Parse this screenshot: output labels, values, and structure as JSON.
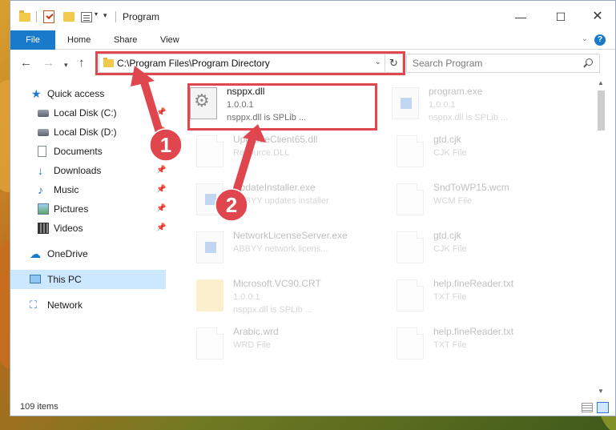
{
  "window": {
    "title": "Program",
    "min_glyph": "—",
    "max_glyph": "☐",
    "close_glyph": "✕"
  },
  "quick_access": {
    "arrow_glyph": "▾",
    "dropdown_glyph": "▾"
  },
  "ribbon": {
    "tabs": [
      "File",
      "Home",
      "Share",
      "View"
    ],
    "collapse_glyph": "⌄",
    "help_glyph": "?"
  },
  "address": {
    "path": "C:\\Program Files\\Program Directory",
    "dropdown_glyph": "⌄",
    "refresh_glyph": "↻",
    "back_glyph": "←",
    "forward_glyph": "→",
    "recent_glyph": "▾",
    "up_glyph": "↑"
  },
  "search": {
    "placeholder": "Search Program"
  },
  "nav": {
    "items": [
      {
        "label": "Quick access",
        "icon": "star-icon",
        "glyph": "★"
      },
      {
        "label": "Local Disk (C:)",
        "icon": "drive-icon",
        "pin": "📌"
      },
      {
        "label": "Local Disk (D:)",
        "icon": "drive-icon",
        "pin": "📌"
      },
      {
        "label": "Documents",
        "icon": "document-icon",
        "pin": "📌"
      },
      {
        "label": "Downloads",
        "icon": "download-icon",
        "glyph": "↓",
        "pin": "📌"
      },
      {
        "label": "Music",
        "icon": "music-icon",
        "glyph": "♪",
        "pin": "📌"
      },
      {
        "label": "Pictures",
        "icon": "pictures-icon",
        "pin": "📌"
      },
      {
        "label": "Videos",
        "icon": "video-icon",
        "pin": "📌"
      },
      {
        "label": "OneDrive",
        "icon": "cloud-icon",
        "glyph": "☁"
      },
      {
        "label": "This PC",
        "icon": "computer-icon"
      },
      {
        "label": "Network",
        "icon": "network-icon",
        "glyph": "⛶"
      }
    ]
  },
  "files": [
    {
      "name": "nsppx.dll",
      "line1": "1.0.0.1",
      "line2": "nsppx.dll is SPLib ...",
      "icon": "settings-file-icon",
      "highlighted": true
    },
    {
      "name": "program.exe",
      "line1": "1.0.0.1",
      "line2": "nsppx.dll is SPLib ...",
      "icon": "exe-icon"
    },
    {
      "name": "UpgradeClient65.dll",
      "line1": "Resource DLL",
      "line2": "",
      "icon": "dll-icon"
    },
    {
      "name": "gtd.cjk",
      "line1": "CJK File",
      "line2": "",
      "icon": "file-icon"
    },
    {
      "name": "UpdateInstaller.exe",
      "line1": "ABBYY updates installer",
      "line2": "",
      "icon": "exe-icon"
    },
    {
      "name": "SndToWP15.wcm",
      "line1": "WCM File",
      "line2": "",
      "icon": "file-icon"
    },
    {
      "name": "NetworkLicenseServer.exe",
      "line1": "ABBYY network licens...",
      "line2": "",
      "icon": "exe-icon"
    },
    {
      "name": "gtd.cjk",
      "line1": "CJK File",
      "line2": "",
      "icon": "file-icon"
    },
    {
      "name": "Microsoft.VC90.CRT",
      "line1": "1.0.0.1",
      "line2": "nsppx.dll is SPLib ...",
      "icon": "folder-icon"
    },
    {
      "name": "help.fineReader.txt",
      "line1": "TXT File",
      "line2": "",
      "icon": "file-icon"
    },
    {
      "name": "Arabic.wrd",
      "line1": "WRD File",
      "line2": "",
      "icon": "file-icon"
    },
    {
      "name": "help.fineReader.txt",
      "line1": "TXT File",
      "line2": "",
      "icon": "file-icon"
    }
  ],
  "scrollbar": {
    "up_glyph": "▲",
    "down_glyph": "▼"
  },
  "status": {
    "item_count": "109 items"
  },
  "annotations": [
    {
      "number": "1",
      "color": "#e0464e"
    },
    {
      "number": "2",
      "color": "#e0464e"
    }
  ]
}
